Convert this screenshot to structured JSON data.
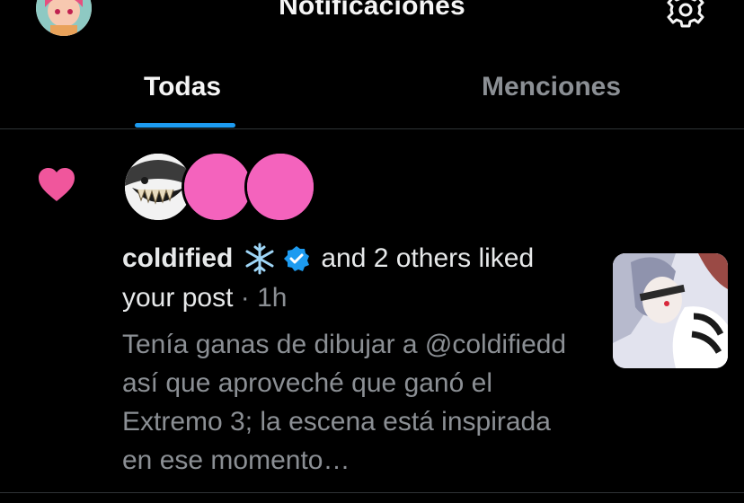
{
  "header": {
    "title": "Notificaciones",
    "avatar_icon": "user-avatar",
    "settings_icon": "gear-icon"
  },
  "tabs": [
    {
      "label": "Todas",
      "active": true
    },
    {
      "label": "Menciones",
      "active": false
    }
  ],
  "colors": {
    "accent": "#1d9bf0",
    "heart": "#f0569c",
    "muted_text": "#8b8f94",
    "background": "#000000"
  },
  "notification": {
    "type_icon": "heart-icon",
    "username": "coldified",
    "emoji_icon": "snowflake-icon",
    "verified_icon": "verified-badge-icon",
    "action_text": "and 2 others liked",
    "line2_text": "your post",
    "separator": " · ",
    "time": "1h",
    "preview_text": "Tenía ganas de dibujar a @coldifiedd así que aproveché que ganó el Extremo 3; la escena está inspirada en ese momento…",
    "thumbnail_icon": "post-thumbnail"
  }
}
